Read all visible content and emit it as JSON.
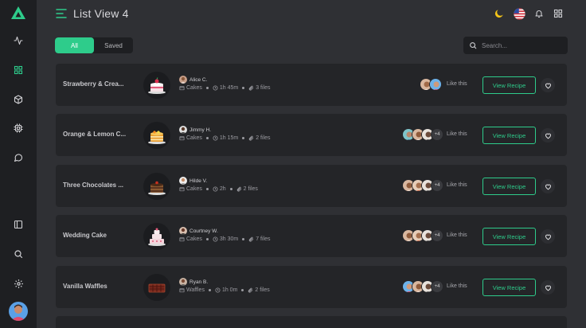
{
  "page": {
    "title": "List View 4"
  },
  "colors": {
    "accent": "#2ecc8b",
    "sidebar": "#1e1f22",
    "background": "#2f3034",
    "card": "#242528"
  },
  "sidebar": {
    "logo": "logo-triangle-icon",
    "items": [
      {
        "name": "activity-icon"
      },
      {
        "name": "grid-icon",
        "active": true
      },
      {
        "name": "cube-icon"
      },
      {
        "name": "cpu-icon"
      },
      {
        "name": "message-circle-icon"
      },
      {
        "name": "sidebar-toggle-icon"
      },
      {
        "name": "search-icon"
      },
      {
        "name": "settings-icon"
      }
    ]
  },
  "topbar": {
    "icons": [
      "moon-icon",
      "us-flag-icon",
      "bell-icon",
      "apps-grid-icon"
    ]
  },
  "tabs": [
    {
      "label": "All",
      "active": true
    },
    {
      "label": "Saved",
      "active": false
    }
  ],
  "search": {
    "placeholder": "Search..."
  },
  "recipes": [
    {
      "title": "Strawberry & Crea...",
      "author": "Alice C.",
      "category": "Cakes",
      "time": "1h 45m",
      "files": "3 files",
      "likers_more": "",
      "like_label": "Like this",
      "button": "View Recipe"
    },
    {
      "title": "Orange & Lemon C...",
      "author": "Jimmy H.",
      "category": "Cakes",
      "time": "1h 15m",
      "files": "2 files",
      "likers_more": "+4",
      "like_label": "Like this",
      "button": "View Recipe"
    },
    {
      "title": "Three Chocolates ...",
      "author": "Hilde V.",
      "category": "Cakes",
      "time": "2h",
      "files": "2 files",
      "likers_more": "+4",
      "like_label": "Like this",
      "button": "View Recipe"
    },
    {
      "title": "Wedding Cake",
      "author": "Courtney W.",
      "category": "Cakes",
      "time": "3h 30m",
      "files": "7 files",
      "likers_more": "+4",
      "like_label": "Like this",
      "button": "View Recipe"
    },
    {
      "title": "Vanilla Waffles",
      "author": "Ryan B.",
      "category": "Waffles",
      "time": "1h 0m",
      "files": "2 files",
      "likers_more": "+4",
      "like_label": "Like this",
      "button": "View Recipe"
    }
  ]
}
